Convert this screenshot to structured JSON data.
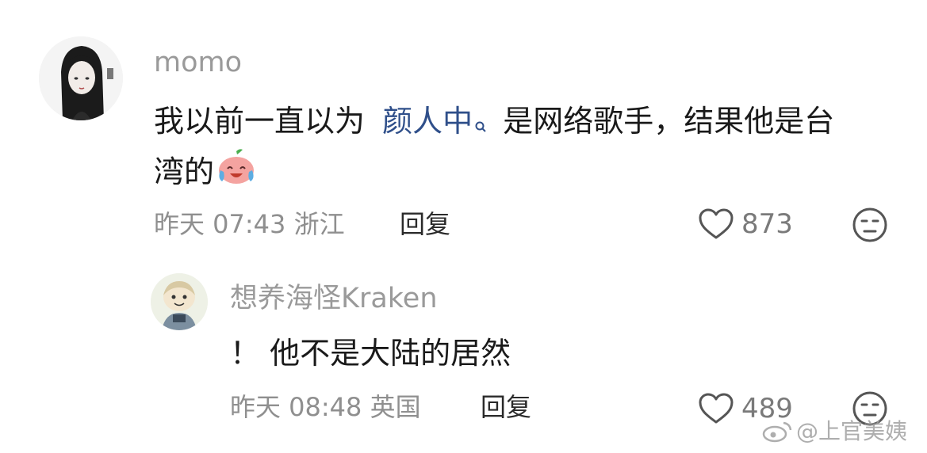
{
  "comment": {
    "username": "momo",
    "text_before": "我以前一直以为",
    "topic": "颜人中",
    "text_after_line1": "是网络歌手，结果他是台",
    "text_line2": "湾的",
    "emoji": "crying-laughing-peach-emoji",
    "time": "昨天 07:43 浙江",
    "reply_label": "回复",
    "like_count": "873"
  },
  "reply": {
    "username": "想养海怪Kraken",
    "text": "！ 他不是大陆的居然",
    "time": "昨天 08:48 英国",
    "reply_label": "回复",
    "like_count": "489"
  },
  "watermark": {
    "text": "@上官美姨"
  }
}
